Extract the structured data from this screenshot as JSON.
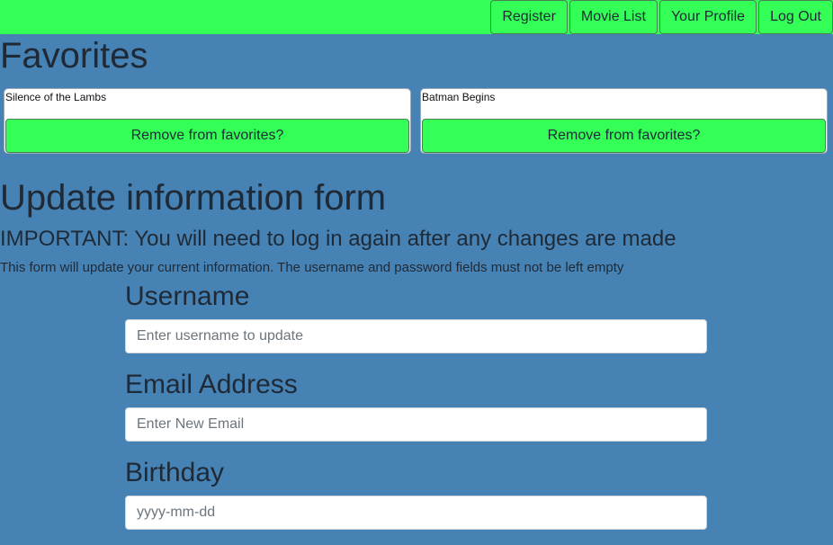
{
  "nav": {
    "items": [
      {
        "label": "Register"
      },
      {
        "label": "Movie List"
      },
      {
        "label": "Your Profile"
      },
      {
        "label": "Log Out"
      }
    ]
  },
  "favorites": {
    "heading": "Favorites",
    "items": [
      {
        "title": "Silence of the Lambs",
        "remove_label": "Remove from favorites?"
      },
      {
        "title": "Batman Begins",
        "remove_label": "Remove from favorites?"
      }
    ]
  },
  "update_form": {
    "heading": "Update information form",
    "important": "IMPORTANT: You will need to log in again after any changes are made",
    "note": "This form will update your current information. The username and password fields must not be left empty",
    "username": {
      "label": "Username",
      "placeholder": "Enter username to update",
      "value": ""
    },
    "email": {
      "label": "Email Address",
      "placeholder": "Enter New Email",
      "value": ""
    },
    "birthday": {
      "label": "Birthday",
      "placeholder": "yyyy-mm-dd",
      "value": ""
    }
  },
  "colors": {
    "background": "#4682b4",
    "accent": "#33ff57",
    "text": "#1f2a36"
  }
}
